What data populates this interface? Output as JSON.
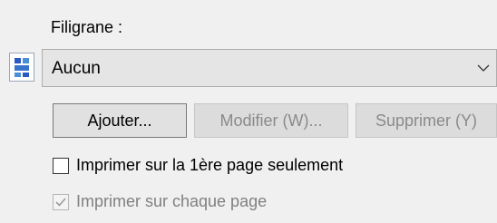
{
  "watermark": {
    "label": "Filigrane :",
    "app_icon": "document-grid-icon",
    "dropdown": {
      "selected": "Aucun",
      "chevron_icon": "chevron-down-icon"
    },
    "buttons": {
      "add": "Ajouter...",
      "modify": "Modifier (W)...",
      "delete": "Supprimer (Y)"
    },
    "options": [
      {
        "label": "Imprimer sur la 1ère page seulement",
        "checked": false,
        "enabled": true
      },
      {
        "label": "Imprimer sur chaque page",
        "checked": true,
        "enabled": false
      }
    ]
  },
  "colors": {
    "background": "#f0f0f0",
    "dropdown_bg": "#e5e5e5",
    "disabled_text": "#8a8a8a"
  }
}
